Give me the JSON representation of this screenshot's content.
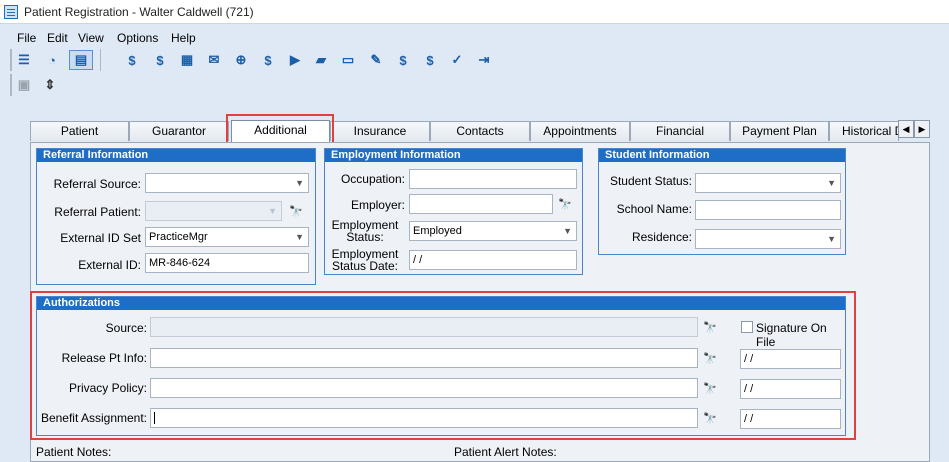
{
  "window": {
    "title": "Patient Registration - Walter Caldwell (721)"
  },
  "menu": {
    "items": [
      "File",
      "Edit",
      "View",
      "Options",
      "Help"
    ]
  },
  "toolbar": {
    "icons": [
      "list-icon",
      "stopwatch-icon",
      "details-icon",
      "dollar-icon",
      "ledger-dollar-icon",
      "calculator-icon",
      "payment-icon",
      "search-money-icon",
      "money-bag-icon",
      "folder-forward-icon",
      "folder-open-icon",
      "document-icon",
      "wrench-icon",
      "statement-dollar-icon",
      "chart-dollar-icon",
      "checklist-icon",
      "exit-icon"
    ],
    "secondary_icons": [
      "print-preview-icon",
      "adjust-icon"
    ]
  },
  "tabs": [
    {
      "label": "Patient"
    },
    {
      "label": "Guarantor"
    },
    {
      "label": "Additional"
    },
    {
      "label": "Insurance"
    },
    {
      "label": "Contacts"
    },
    {
      "label": "Appointments"
    },
    {
      "label": "Financial"
    },
    {
      "label": "Payment Plan"
    },
    {
      "label": "Historical D"
    }
  ],
  "referral": {
    "heading": "Referral Information",
    "source_label": "Referral Source:",
    "source_value": "",
    "patient_label": "Referral Patient:",
    "patient_value": "",
    "ext_id_set_label": "External ID Set",
    "ext_id_set_value": "PracticeMgr",
    "ext_id_label": "External ID:",
    "ext_id_value": "MR-846-624"
  },
  "employment": {
    "heading": "Employment Information",
    "occupation_label": "Occupation:",
    "occupation_value": "",
    "employer_label": "Employer:",
    "employer_value": "",
    "status_label_1": "Employment",
    "status_label_2": "Status:",
    "status_value": "Employed",
    "date_label_1": "Employment",
    "date_label_2": "Status Date:",
    "date_value": " / /"
  },
  "student": {
    "heading": "Student Information",
    "status_label": "Student Status:",
    "status_value": "",
    "school_label": "School Name:",
    "school_value": "",
    "residence_label": "Residence:",
    "residence_value": ""
  },
  "authorizations": {
    "heading": "Authorizations",
    "source_label": "Source:",
    "source_value": "",
    "signature_label": "Signature On File",
    "signature_checked": false,
    "release_label": "Release Pt Info:",
    "release_value": "",
    "release_date": " / /",
    "privacy_label": "Privacy Policy:",
    "privacy_value": "",
    "privacy_date": " / /",
    "benefit_label": "Benefit Assignment:",
    "benefit_value": "",
    "benefit_date": " / /"
  },
  "notes": {
    "patient_notes_label": "Patient Notes:",
    "alert_notes_label": "Patient Alert Notes:"
  },
  "colors": {
    "group_header": "#1e6ec8",
    "highlight": "#e04040",
    "background": "#dfe9f5"
  }
}
